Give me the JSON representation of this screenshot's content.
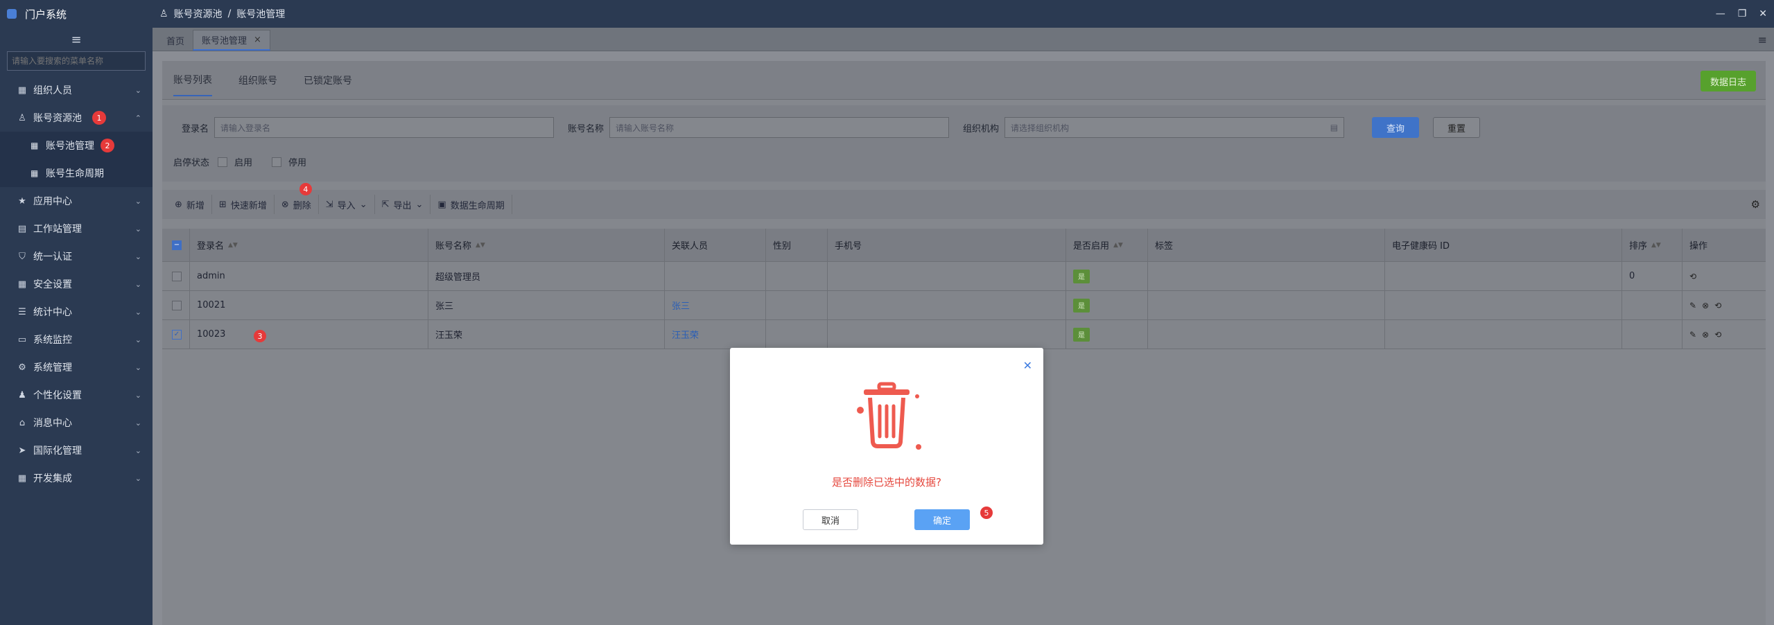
{
  "app": {
    "title": "门户系统"
  },
  "sidebar": {
    "search_placeholder": "请输入要搜索的菜单名称",
    "items": [
      {
        "label": "组织人员",
        "icon": "grid-icon"
      },
      {
        "label": "账号资源池",
        "icon": "user-icon",
        "badge": "1"
      },
      {
        "label": "应用中心",
        "icon": "star-icon"
      },
      {
        "label": "工作站管理",
        "icon": "workstation-icon"
      },
      {
        "label": "统一认证",
        "icon": "shield-icon"
      },
      {
        "label": "安全设置",
        "icon": "grid-icon"
      },
      {
        "label": "统计中心",
        "icon": "list-icon"
      },
      {
        "label": "系统监控",
        "icon": "monitor-icon"
      },
      {
        "label": "系统管理",
        "icon": "cog-icon"
      },
      {
        "label": "个性化设置",
        "icon": "people-icon"
      },
      {
        "label": "消息中心",
        "icon": "home-icon"
      },
      {
        "label": "国际化管理",
        "icon": "send-icon"
      },
      {
        "label": "开发集成",
        "icon": "grid-icon"
      }
    ],
    "sub_items": [
      {
        "label": "账号池管理",
        "badge": "2"
      },
      {
        "label": "账号生命周期"
      }
    ]
  },
  "topbar": {
    "breadcrumb": [
      "账号资源池",
      "账号池管理"
    ],
    "separator": "/"
  },
  "tabs": [
    {
      "label": "首页"
    },
    {
      "label": "账号池管理"
    }
  ],
  "subtabs": [
    {
      "label": "账号列表"
    },
    {
      "label": "组织账号"
    },
    {
      "label": "已锁定账号"
    }
  ],
  "log_button": "数据日志",
  "filter": {
    "login_label": "登录名",
    "login_placeholder": "请输入登录名",
    "account_label": "账号名称",
    "account_placeholder": "请输入账号名称",
    "org_label": "组织机构",
    "org_placeholder": "请选择组织机构",
    "query": "查询",
    "reset": "重置",
    "status_label": "启停状态",
    "enable": "启用",
    "disable": "停用"
  },
  "toolbar": {
    "add": "新增",
    "quick_add": "快速新增",
    "delete": "删除",
    "delete_badge": "4",
    "import": "导入",
    "export": "导出",
    "lifecycle": "数据生命周期"
  },
  "table": {
    "columns": [
      "登录名",
      "账号名称",
      "关联人员",
      "性别",
      "手机号",
      "是否启用",
      "标签",
      "电子健康码 ID",
      "排序",
      "操作"
    ],
    "rows": [
      {
        "login": "admin",
        "name": "超级管理员",
        "person": "",
        "order": "0",
        "checked": false
      },
      {
        "login": "10021",
        "name": "张三",
        "person": "张三",
        "order": "",
        "checked": false
      },
      {
        "login": "10023",
        "name": "汪玉荣",
        "person": "汪玉荣",
        "order": "",
        "checked": true,
        "badge": "3"
      }
    ],
    "status_value": "是"
  },
  "modal": {
    "message": "是否删除已选中的数据?",
    "cancel": "取消",
    "confirm": "确定",
    "badge": "5"
  }
}
